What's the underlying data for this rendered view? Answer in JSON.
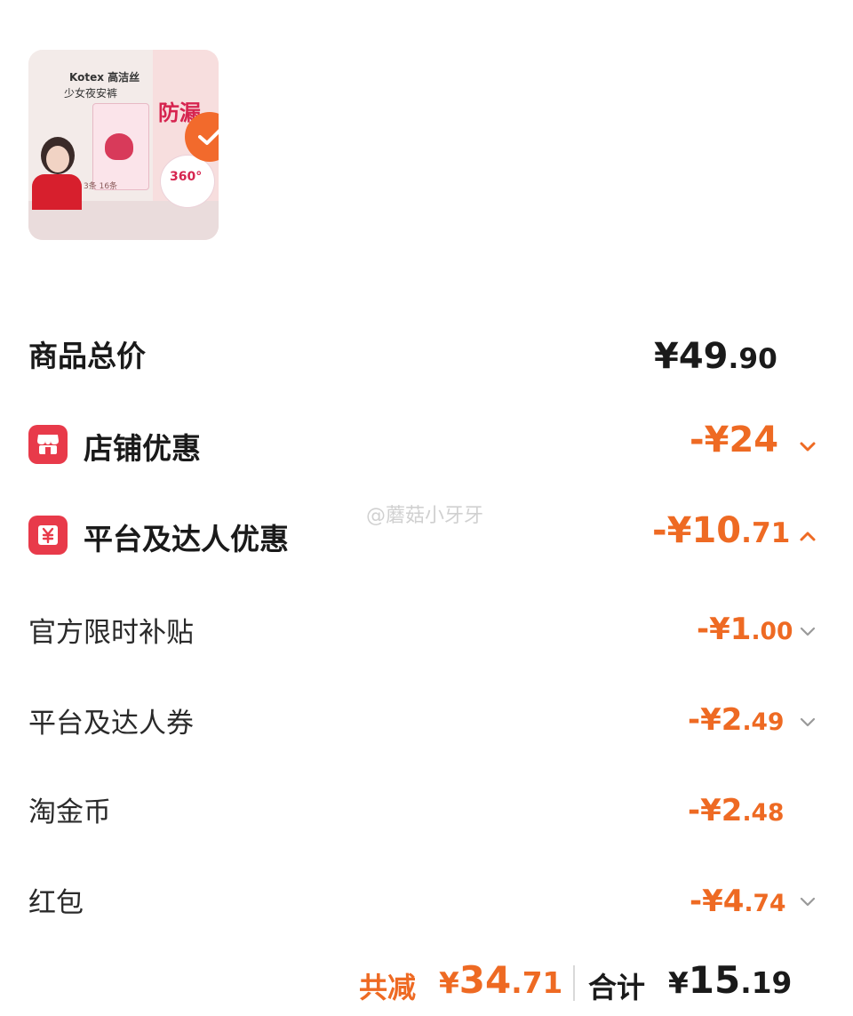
{
  "product": {
    "brand": "Kotex 高洁丝",
    "name": "少女夜安裤",
    "side_text": "防漏",
    "badge": "360°",
    "count": "3条 16条",
    "selected": true
  },
  "watermark": "@蘑菇小牙牙",
  "total": {
    "label": "商品总价",
    "currency": "¥",
    "int": "49",
    "dec": ".90"
  },
  "discounts": [
    {
      "label": "店铺优惠",
      "sign": "-¥",
      "int": "24",
      "dec": "",
      "chevron": "chevron-down-icon",
      "icon": "shop-icon"
    },
    {
      "label": "平台及达人优惠",
      "sign": "-¥",
      "int": "10",
      "dec": ".71",
      "chevron": "chevron-up-icon",
      "icon": "yuan-coupon-icon"
    }
  ],
  "sub_discounts": [
    {
      "label": "官方限时补贴",
      "sign": "-¥",
      "int": "1",
      "dec": ".00",
      "chevron": true
    },
    {
      "label": "平台及达人券",
      "sign": "-¥",
      "int": "2",
      "dec": ".49",
      "chevron": true
    },
    {
      "label": "淘金币",
      "sign": "-¥",
      "int": "2",
      "dec": ".48",
      "chevron": false
    },
    {
      "label": "红包",
      "sign": "-¥",
      "int": "4",
      "dec": ".74",
      "chevron": true
    }
  ],
  "summary": {
    "reduce_label": "共减",
    "reduce_sign": "¥",
    "reduce_int": "34",
    "reduce_dec": ".71",
    "sum_label": "合计",
    "sum_sign": "¥",
    "sum_int": "15",
    "sum_dec": ".19"
  },
  "colors": {
    "accent": "#ee6a23",
    "icon_bg": "#e83a4a",
    "check": "#f26a2c"
  }
}
